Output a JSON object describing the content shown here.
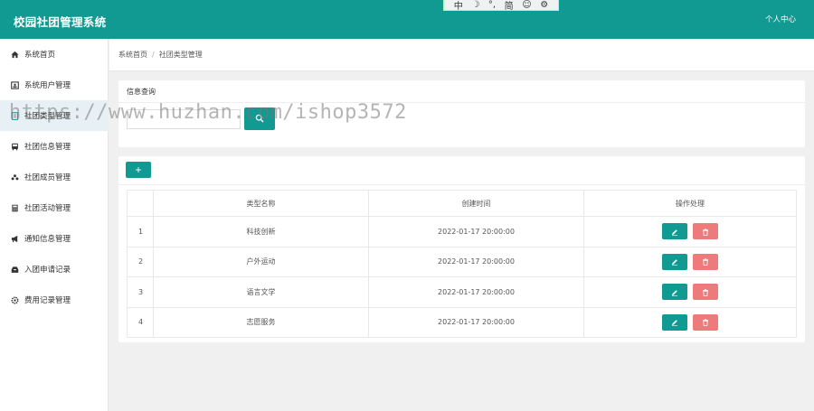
{
  "header": {
    "app_title": "校园社团管理系统",
    "user_center": "个人中心"
  },
  "ime_bar": {
    "items": [
      "中",
      "☽",
      "°,",
      "简",
      "☺",
      "⚙"
    ]
  },
  "sidebar": {
    "items": [
      {
        "label": "系统首页",
        "icon": "home-icon"
      },
      {
        "label": "系统用户管理",
        "icon": "user-card-icon"
      },
      {
        "label": "社团类型管理",
        "icon": "list-icon"
      },
      {
        "label": "社团信息管理",
        "icon": "bus-icon"
      },
      {
        "label": "社团成员管理",
        "icon": "users-icon"
      },
      {
        "label": "社团活动管理",
        "icon": "calculator-icon"
      },
      {
        "label": "通知信息管理",
        "icon": "megaphone-icon"
      },
      {
        "label": "入团申请记录",
        "icon": "inbox-icon"
      },
      {
        "label": "费用记录管理",
        "icon": "gear-icon"
      }
    ]
  },
  "breadcrumb": {
    "home": "系统首页",
    "separator": "/",
    "current": "社团类型管理"
  },
  "query": {
    "title": "信息查询",
    "input_placeholder": ""
  },
  "list": {
    "add_label": "+",
    "columns": [
      "",
      "类型名称",
      "创建时间",
      "操作处理"
    ],
    "rows": [
      {
        "no": "1",
        "name": "科技创新",
        "created": "2022-01-17 20:00:00"
      },
      {
        "no": "2",
        "name": "户外运动",
        "created": "2022-01-17 20:00:00"
      },
      {
        "no": "3",
        "name": "语言文学",
        "created": "2022-01-17 20:00:00"
      },
      {
        "no": "4",
        "name": "志愿服务",
        "created": "2022-01-17 20:00:00"
      }
    ]
  },
  "watermark": "https://www.huzhan.com/ishop3572",
  "colors": {
    "primary": "#119a92",
    "danger": "#ee7b7b",
    "sidebar_active": "#e7f1f5",
    "background": "#f0f0f0"
  }
}
